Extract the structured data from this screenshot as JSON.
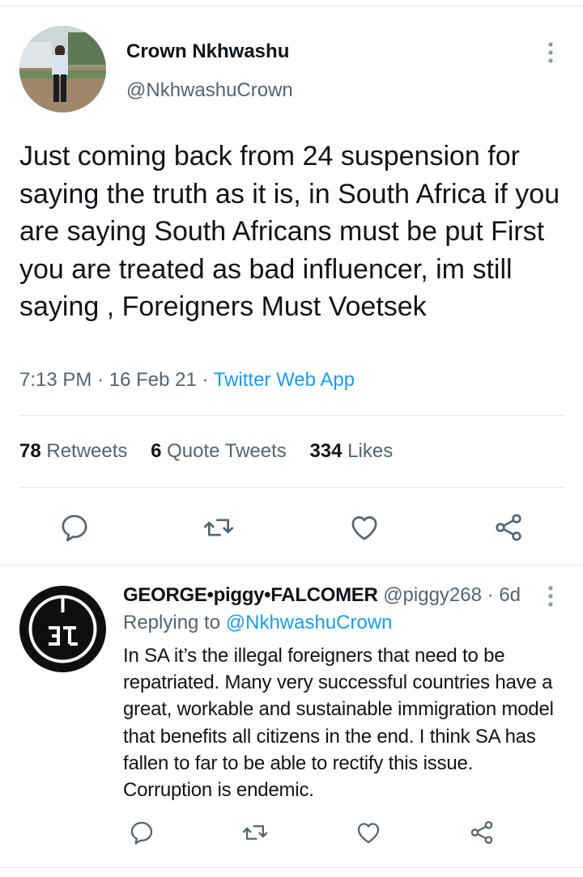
{
  "tweet": {
    "author_name": "Crown Nkhwashu",
    "author_handle": "@NkhwashuCrown",
    "text": "Just coming back from 24 suspension for saying the truth as it is, in South Africa if you are saying South Africans must be put First you are treated as bad influencer, im still saying , Foreigners Must Voetsek",
    "time": "7:13 PM",
    "date": "16 Feb 21",
    "source": "Twitter Web App",
    "stats": {
      "retweets_count": "78",
      "retweets_label": "Retweets",
      "quotes_count": "6",
      "quotes_label": "Quote Tweets",
      "likes_count": "334",
      "likes_label": "Likes"
    }
  },
  "reply": {
    "author_name": "GEORGE•piggy•FALCOMER",
    "author_handle": "@piggy268",
    "age": "6d",
    "replying_label": "Replying to",
    "replying_to": "@NkhwashuCrown",
    "text": "In SA it’s the illegal foreigners that need to be repatriated. Many very successful countries have a great, workable and sustainable immigration model that benefits all citizens in the end. I think SA has fallen to far to be able to rectify this issue. Corruption is endemic."
  },
  "icons": {
    "reply": "reply-icon",
    "retweet": "retweet-icon",
    "like": "like-icon",
    "share": "share-icon",
    "more": "more-icon"
  },
  "colors": {
    "text": "#0f1419",
    "secondary": "#536471",
    "accent": "#1d9bf0",
    "divider": "#e1e8ed"
  }
}
